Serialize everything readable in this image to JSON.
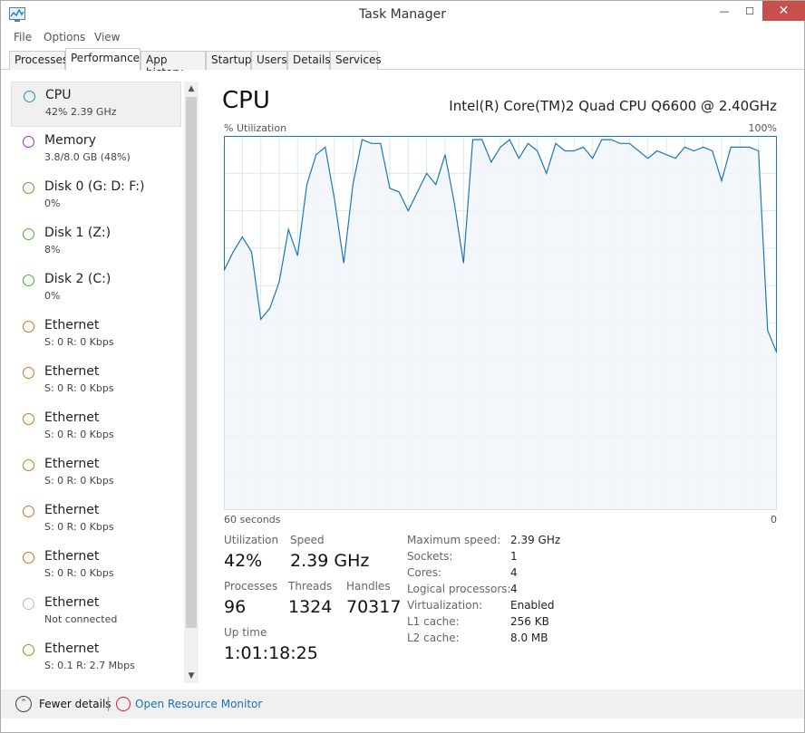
{
  "window": {
    "title": "Task Manager",
    "minimize_glyph": "—",
    "maximize_glyph": "☐",
    "close_glyph": "✕"
  },
  "menu": [
    "File",
    "Options",
    "View"
  ],
  "tabs": [
    "Processes",
    "Performance",
    "App history",
    "Startup",
    "Users",
    "Details",
    "Services"
  ],
  "active_tab": "Performance",
  "sidebar": {
    "scroll_up_glyph": "▲",
    "scroll_down_glyph": "▼",
    "items": [
      {
        "title": "CPU",
        "sub": "42% 2.39 GHz",
        "color": "#1a8ed4",
        "selected": true
      },
      {
        "title": "Memory",
        "sub": "3.8/8.0 GB (48%)",
        "color": "#a12dc4",
        "selected": false
      },
      {
        "title": "Disk 0 (G: D: F:)",
        "sub": "0%",
        "color": "#4ea832",
        "selected": false
      },
      {
        "title": "Disk 1 (Z:)",
        "sub": "8%",
        "color": "#4ea832",
        "selected": false
      },
      {
        "title": "Disk 2 (C:)",
        "sub": "0%",
        "color": "#4ea832",
        "selected": false
      },
      {
        "title": "Ethernet",
        "sub": "S: 0 R: 0 Kbps",
        "color": "#c8761e",
        "selected": false
      },
      {
        "title": "Ethernet",
        "sub": "S: 0 R: 0 Kbps",
        "color": "#c8761e",
        "selected": false
      },
      {
        "title": "Ethernet",
        "sub": "S: 0 R: 0 Kbps",
        "color": "#c8761e",
        "selected": false
      },
      {
        "title": "Ethernet",
        "sub": "S: 0 R: 0 Kbps",
        "color": "#c8761e",
        "selected": false
      },
      {
        "title": "Ethernet",
        "sub": "S: 0 R: 0 Kbps",
        "color": "#c8761e",
        "selected": false
      },
      {
        "title": "Ethernet",
        "sub": "S: 0 R: 0 Kbps",
        "color": "#c8761e",
        "selected": false
      },
      {
        "title": "Ethernet",
        "sub": "Not connected",
        "color": "#bbbbbb",
        "selected": false
      },
      {
        "title": "Ethernet",
        "sub": "S: 0.1 R: 2.7 Mbps",
        "color": "#c8761e",
        "selected": false
      }
    ]
  },
  "main": {
    "title": "CPU",
    "cpu_name": "Intel(R) Core(TM)2 Quad CPU Q6600 @ 2.40GHz",
    "util_label": "% Utilization",
    "util_max": "100%",
    "axis_left": "60 seconds",
    "axis_right": "0",
    "stats": {
      "utilization_label": "Utilization",
      "utilization": "42%",
      "speed_label": "Speed",
      "speed": "2.39 GHz",
      "processes_label": "Processes",
      "processes": "96",
      "threads_label": "Threads",
      "threads": "1324",
      "handles_label": "Handles",
      "handles": "70317",
      "uptime_label": "Up time",
      "uptime": "1:01:18:25"
    },
    "specs": [
      {
        "label": "Maximum speed:",
        "value": "2.39 GHz"
      },
      {
        "label": "Sockets:",
        "value": "1"
      },
      {
        "label": "Cores:",
        "value": "4"
      },
      {
        "label": "Logical processors:",
        "value": "4"
      },
      {
        "label": "Virtualization:",
        "value": "Enabled"
      },
      {
        "label": "L1 cache:",
        "value": "256 KB"
      },
      {
        "label": "L2 cache:",
        "value": "8.0 MB"
      }
    ]
  },
  "chart_data": {
    "type": "area",
    "ylim": [
      0,
      100
    ],
    "xlim": [
      60,
      0
    ],
    "x": [
      60,
      59,
      58,
      57,
      56,
      55,
      54,
      53,
      52,
      51,
      50,
      49,
      48,
      47,
      46,
      45,
      44,
      43,
      42,
      41,
      40,
      39,
      38,
      37,
      36,
      35,
      34,
      33,
      32,
      31,
      30,
      29,
      28,
      27,
      26,
      25,
      24,
      23,
      22,
      21,
      20,
      19,
      18,
      17,
      16,
      15,
      14,
      13,
      12,
      11,
      10,
      9,
      8,
      7,
      6,
      5,
      4,
      3,
      2,
      1,
      0
    ],
    "values": [
      64,
      69,
      73,
      69,
      51,
      54,
      61,
      75,
      68,
      87,
      95,
      97,
      83,
      66,
      87,
      99,
      98,
      98,
      86,
      85,
      80,
      85,
      90,
      87,
      95,
      82,
      66,
      99,
      99,
      93,
      97,
      99,
      94,
      98,
      96,
      90,
      98,
      96,
      96,
      97,
      94,
      99,
      99,
      98,
      98,
      96,
      94,
      96,
      95,
      94,
      97,
      96,
      97,
      96,
      88,
      97,
      97,
      97,
      96,
      48,
      42
    ],
    "line_color": "#1a78b8",
    "fill_color": "#f1f6fa",
    "grid_color": "#d9e8f2"
  },
  "footer": {
    "fewer_glyph": "⌃",
    "fewer_label": "Fewer details",
    "orm_label": "Open Resource Monitor"
  }
}
